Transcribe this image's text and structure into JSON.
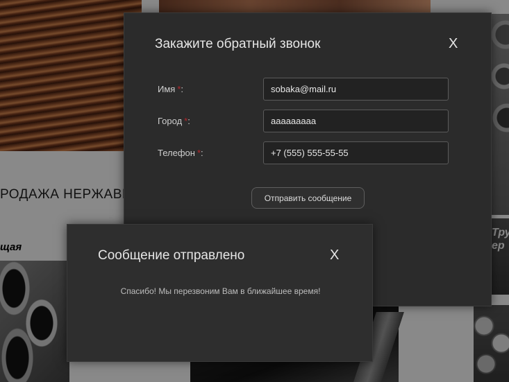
{
  "background": {
    "heading": "РОДАЖА НЕРЖАВЕ",
    "subheading": "щая",
    "side_text": "Тру\nер"
  },
  "callback_modal": {
    "title": "Закажите обратный звонок",
    "close_label": "X",
    "fields": [
      {
        "label": "Имя",
        "required_mark": "*",
        "suffix": ":",
        "value": "sobaka@mail.ru"
      },
      {
        "label": "Город",
        "required_mark": "*",
        "suffix": ":",
        "value": "ааааааааа"
      },
      {
        "label": "Телефон",
        "required_mark": "*",
        "suffix": ":",
        "value": "+7 (555) 555-55-55"
      }
    ],
    "submit_label": "Отправить сообщение"
  },
  "success_modal": {
    "title": "Сообщение отправлено",
    "close_label": "X",
    "message": "Спасибо! Мы перезвоним Вам в ближайшее время!"
  },
  "colors": {
    "modal_bg": "#2b2b2b",
    "required_star": "#b3262c",
    "text": "#e6e6e6"
  }
}
